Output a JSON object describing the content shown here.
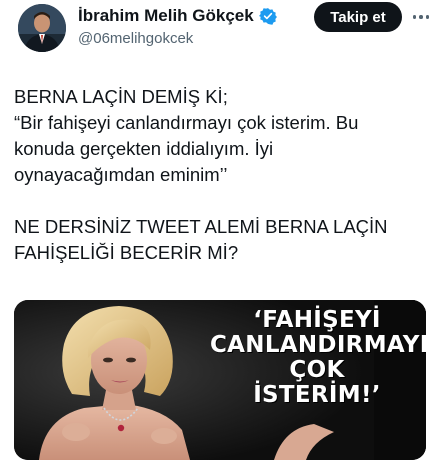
{
  "author": {
    "display_name": "İbrahim Melih Gökçek",
    "handle": "@06melihgokcek",
    "verified_icon": "verified-badge-icon",
    "verified_color": "#1d9bf0"
  },
  "actions": {
    "follow_label": "Takip et",
    "more_icon": "more-horizontal-icon"
  },
  "tweet": {
    "lines_1": [
      "BERNA LAÇİN DEMİŞ Kİ;",
      "“Bir fahişeyi canlandırmayı çok isterim. Bu",
      "konuda gerçekten iddialıyım. İyi",
      "oynayacağımdan eminim’’"
    ],
    "lines_2": [
      "NE DERSİNİZ TWEET ALEMİ  BERNA LAÇİN",
      "FAHİŞELİĞİ BECERİR Mİ?"
    ]
  },
  "media": {
    "overlay_lines": [
      "‘FAHİŞEYİ",
      "CANLANDIRMAYI",
      "ÇOK",
      "İSTERİM!’"
    ]
  },
  "colors": {
    "text_primary": "#0f1419",
    "text_secondary": "#536471",
    "button_bg": "#0f1419"
  }
}
